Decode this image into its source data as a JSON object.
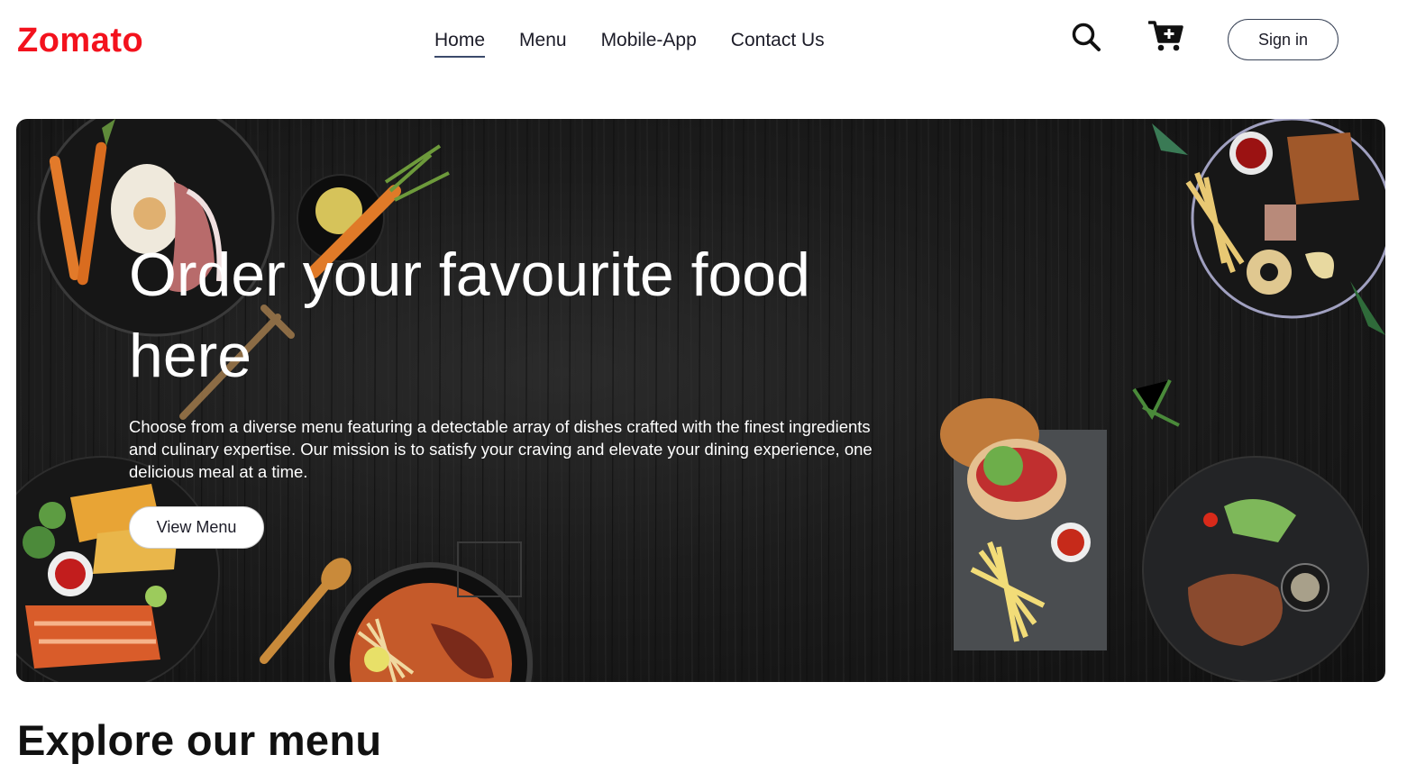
{
  "brand": {
    "logo_text": "Zomato",
    "accent_color": "#f3121d"
  },
  "nav": {
    "items": [
      {
        "label": "Home",
        "active": true
      },
      {
        "label": "Menu",
        "active": false
      },
      {
        "label": "Mobile-App",
        "active": false
      },
      {
        "label": "Contact Us",
        "active": false
      }
    ],
    "search_icon": "search-icon",
    "cart_icon": "cart-plus-icon",
    "signin_label": "Sign in"
  },
  "hero": {
    "title": "Order your favourite food here",
    "description": "Choose from a diverse menu featuring a detectable array of dishes crafted with the finest ingredients and culinary expertise. Our mission is to satisfy your craving and elevate your dining experience, one delicious meal at a time.",
    "button_label": "View Menu",
    "background": "dark wooden table with food plates"
  },
  "section": {
    "title": "Explore our menu"
  }
}
